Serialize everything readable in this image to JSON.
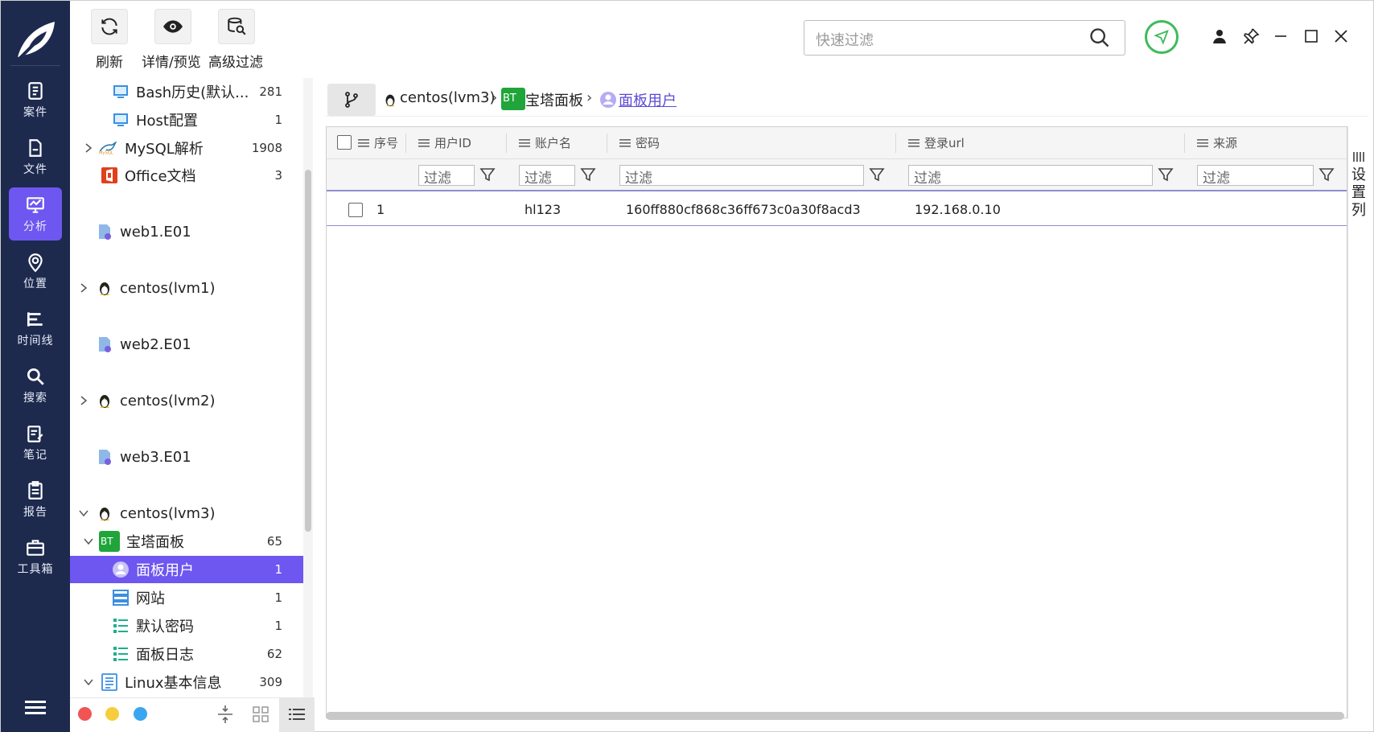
{
  "rail": {
    "items": [
      {
        "label": "案件",
        "icon": "clipboard-icon"
      },
      {
        "label": "文件",
        "icon": "file-icon"
      },
      {
        "label": "分析",
        "icon": "monitor-chart-icon"
      },
      {
        "label": "位置",
        "icon": "location-icon"
      },
      {
        "label": "时间线",
        "icon": "timeline-icon"
      },
      {
        "label": "搜索",
        "icon": "search-icon"
      },
      {
        "label": "笔记",
        "icon": "note-icon"
      },
      {
        "label": "报告",
        "icon": "report-icon"
      },
      {
        "label": "工具箱",
        "icon": "toolbox-icon"
      }
    ],
    "active": "分析",
    "accent": "#6e56f0",
    "background": "#1d2a4e"
  },
  "toolbar": {
    "refresh_label": "刷新",
    "preview_label": "详情/预览",
    "advanced_filter_label": "高级过滤"
  },
  "search": {
    "placeholder": "快速过滤"
  },
  "tree": {
    "items": [
      {
        "label": "Bash历史(默认...",
        "count": "281"
      },
      {
        "label": "Host配置",
        "count": "1"
      },
      {
        "label": "MySQL解析",
        "count": "1908"
      },
      {
        "label": "Office文档",
        "count": "3"
      },
      {
        "label": "web1.E01",
        "count": ""
      },
      {
        "label": "centos(lvm1)",
        "count": ""
      },
      {
        "label": "web2.E01",
        "count": ""
      },
      {
        "label": "centos(lvm2)",
        "count": ""
      },
      {
        "label": "web3.E01",
        "count": ""
      },
      {
        "label": "centos(lvm3)",
        "count": ""
      },
      {
        "label": "宝塔面板",
        "count": "65"
      },
      {
        "label": "面板用户",
        "count": "1"
      },
      {
        "label": "网站",
        "count": "1"
      },
      {
        "label": "默认密码",
        "count": "1"
      },
      {
        "label": "面板日志",
        "count": "62"
      },
      {
        "label": "Linux基本信息",
        "count": "309"
      }
    ],
    "selected": "面板用户"
  },
  "breadcrumb": {
    "items": [
      "centos(lvm3)",
      "宝塔面板",
      "面板用户"
    ],
    "separator": "›",
    "bt_badge": "BT"
  },
  "table": {
    "columns": [
      "序号",
      "用户ID",
      "账户名",
      "密码",
      "登录url",
      "来源"
    ],
    "filter_placeholder": "过滤",
    "rows": [
      [
        "1",
        "",
        "hl123",
        "160ff880cf868c36ff673c0a30f8acd3",
        "192.168.0.10",
        ""
      ]
    ]
  },
  "side_tab": {
    "label": "设置列"
  },
  "colors": {
    "selection": "#6e56f0",
    "nav_ring": "#3dbb5a",
    "link": "#5b4ad6"
  }
}
